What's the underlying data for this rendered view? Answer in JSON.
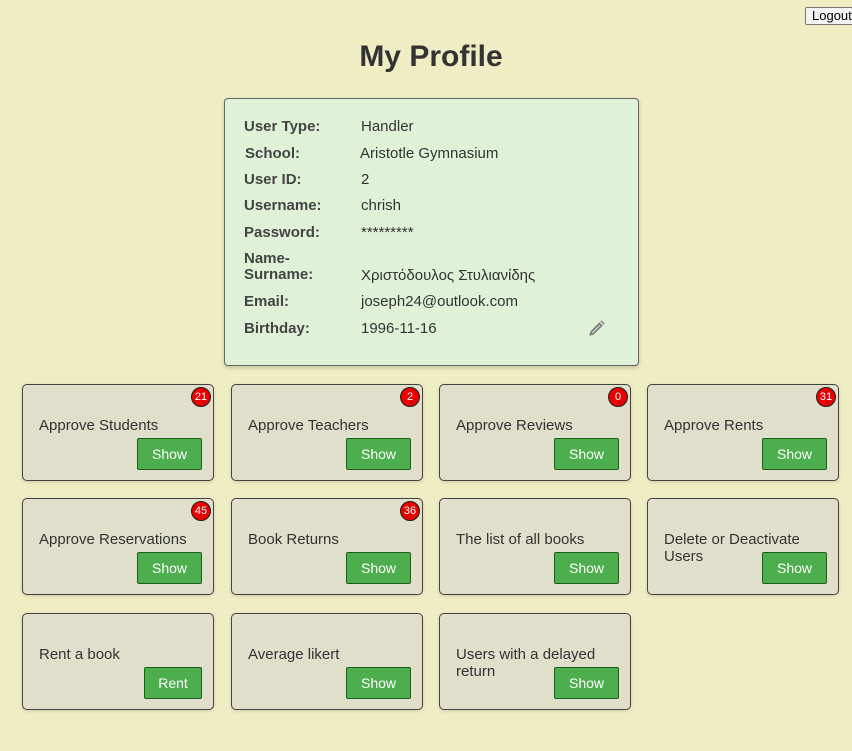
{
  "header": {
    "logout_label": "Logout"
  },
  "page": {
    "title": "My Profile"
  },
  "profile": {
    "fields": [
      {
        "label": "User Type:",
        "value": "Handler"
      },
      {
        "label": "School:",
        "value": "Aristotle Gymnasium"
      },
      {
        "label": "User ID:",
        "value": "2"
      },
      {
        "label": "Username:",
        "value": "chrish"
      },
      {
        "label": "Password:",
        "value": "*********"
      },
      {
        "label": "Name-\nSurname:",
        "value": "Χριστόδουλος Στυλιανίδης"
      },
      {
        "label": "Email:",
        "value": "joseph24@outlook.com"
      },
      {
        "label": "Birthday:",
        "value": "1996-11-16"
      }
    ],
    "edit_icon": "pencil-icon"
  },
  "tiles": [
    {
      "label": "Approve Students",
      "button": "Show",
      "badge": "21"
    },
    {
      "label": "Approve Teachers",
      "button": "Show",
      "badge": "2"
    },
    {
      "label": "Approve Reviews",
      "button": "Show",
      "badge": "0"
    },
    {
      "label": "Approve Rents",
      "button": "Show",
      "badge": "31"
    },
    {
      "label": "Approve Reservations",
      "button": "Show",
      "badge": "45"
    },
    {
      "label": "Book Returns",
      "button": "Show",
      "badge": "36"
    },
    {
      "label": "The list of all books",
      "button": "Show"
    },
    {
      "label": "Delete or Deactivate Users",
      "button": "Show"
    },
    {
      "label": "Rent a book",
      "button": "Rent"
    },
    {
      "label": "Average likert",
      "button": "Show"
    },
    {
      "label": "Users with a delayed return",
      "button": "Show"
    }
  ],
  "colors": {
    "background": "#efedc4",
    "profile_card": "#dff2d8",
    "tile": "#dfdfcb",
    "button": "#4cae4c",
    "badge": "#e60000"
  }
}
